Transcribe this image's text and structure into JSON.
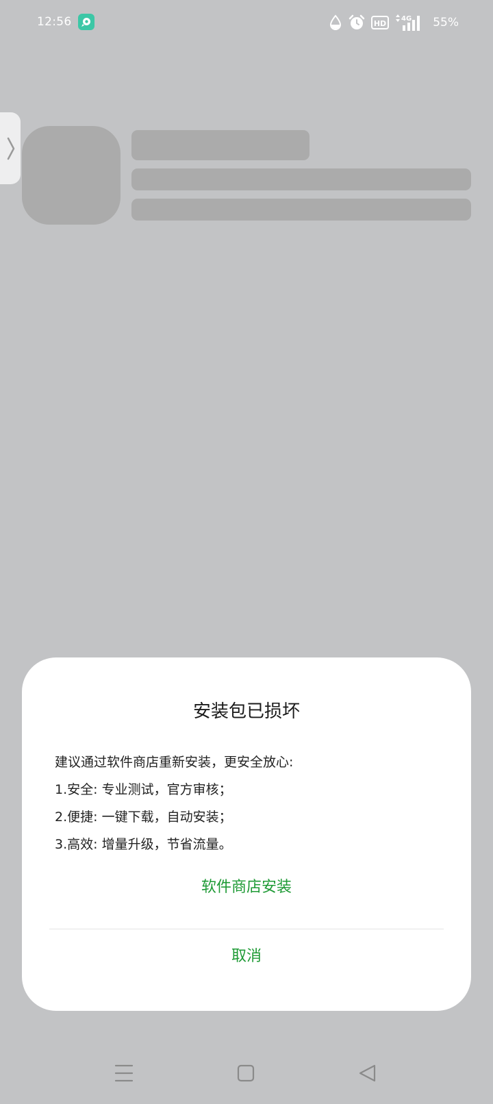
{
  "status_bar": {
    "time": "12:56",
    "app_icon": "app-notification-icon",
    "icons": [
      "water-drop-icon",
      "alarm-clock-icon",
      "hd-icon",
      "4g-signal-icon"
    ],
    "network": "4G",
    "battery_percent": "55%"
  },
  "dialog": {
    "title": "安装包已损坏",
    "body_lines": [
      "建议通过软件商店重新安装，更安全放心:",
      "1.安全:  专业测试，官方审核；",
      "2.便捷:  一键下载，自动安装；",
      "3.高效:  增量升级，节省流量。"
    ],
    "primary_button": "软件商店安装",
    "cancel_button": "取消"
  },
  "colors": {
    "accent": "#1e9a35",
    "overlay_background": "#c2c3c5",
    "skeleton": "#ababab",
    "dialog_background": "#ffffff"
  },
  "nav_bar": {
    "icons": [
      "menu-icon",
      "home-icon",
      "back-icon"
    ]
  }
}
